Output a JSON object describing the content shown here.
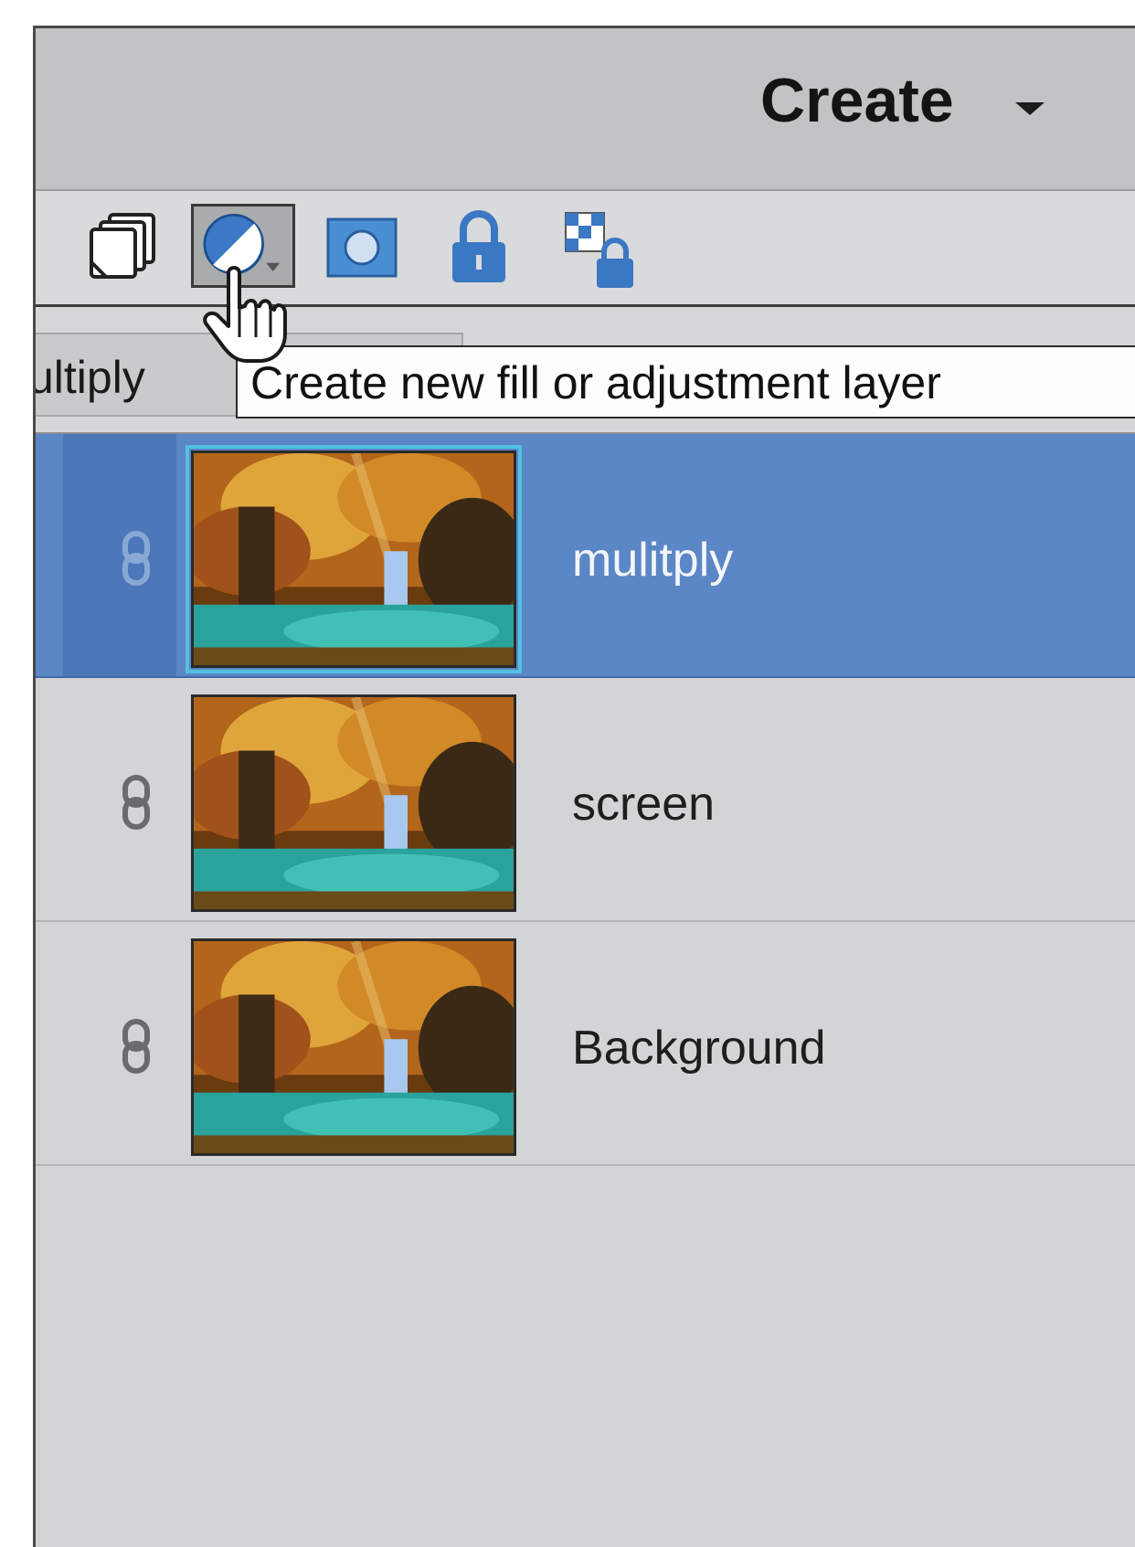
{
  "header": {
    "create_label": "Create",
    "dropdown_icon": "chevron-down-icon"
  },
  "toolbar": {
    "tools": [
      {
        "name": "new-layer",
        "icon": "stacked-pages-icon"
      },
      {
        "name": "adjustment-layer",
        "icon": "half-circle-adjust-icon",
        "state": "hover"
      },
      {
        "name": "layer-mask",
        "icon": "mask-icon"
      },
      {
        "name": "lock-all",
        "icon": "padlock-icon"
      },
      {
        "name": "lock-transparent",
        "icon": "checker-lock-icon"
      }
    ]
  },
  "blend_mode": {
    "value": "ultiply"
  },
  "tooltip": {
    "text": "Create new fill or adjustment layer"
  },
  "layers": [
    {
      "name": "mulitply",
      "selected": true
    },
    {
      "name": "screen",
      "selected": false
    },
    {
      "name": "Background",
      "selected": false
    }
  ],
  "colors": {
    "selection": "#5b87c6",
    "panel": "#d2d4d5",
    "header": "#c2c3c4",
    "icon_blue": "#3f7fc8"
  }
}
